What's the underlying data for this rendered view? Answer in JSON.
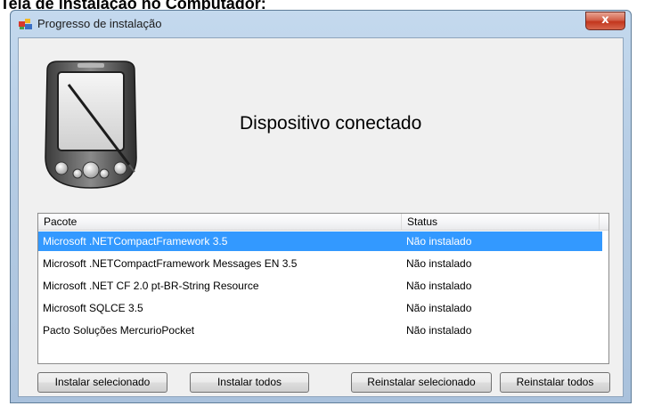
{
  "document": {
    "heading": "Tela de instalação no Computador:"
  },
  "window": {
    "title": "Progresso de instalação",
    "close_label": "x"
  },
  "main": {
    "status_title": "Dispositivo conectado"
  },
  "table": {
    "columns": [
      "Pacote",
      "Status"
    ],
    "rows": [
      {
        "package": "Microsoft .NETCompactFramework 3.5",
        "status": "Não instalado",
        "selected": true
      },
      {
        "package": "Microsoft .NETCompactFramework Messages EN 3.5",
        "status": "Não instalado",
        "selected": false
      },
      {
        "package": "Microsoft .NET CF 2.0 pt-BR-String Resource",
        "status": "Não instalado",
        "selected": false
      },
      {
        "package": "Microsoft SQLCE 3.5",
        "status": "Não instalado",
        "selected": false
      },
      {
        "package": "Pacto Soluções MercurioPocket",
        "status": "Não instalado",
        "selected": false
      }
    ]
  },
  "buttons": {
    "install_selected": "Instalar selecionado",
    "install_all": "Instalar todos",
    "reinstall_selected": "Reinstalar selecionado",
    "reinstall_all": "Reinstalar todos"
  },
  "colors": {
    "selection": "#3399ff",
    "close_button": "#c3361d"
  },
  "icons": {
    "app_icon": "installer-package-icon",
    "device": "pda-device-icon"
  }
}
